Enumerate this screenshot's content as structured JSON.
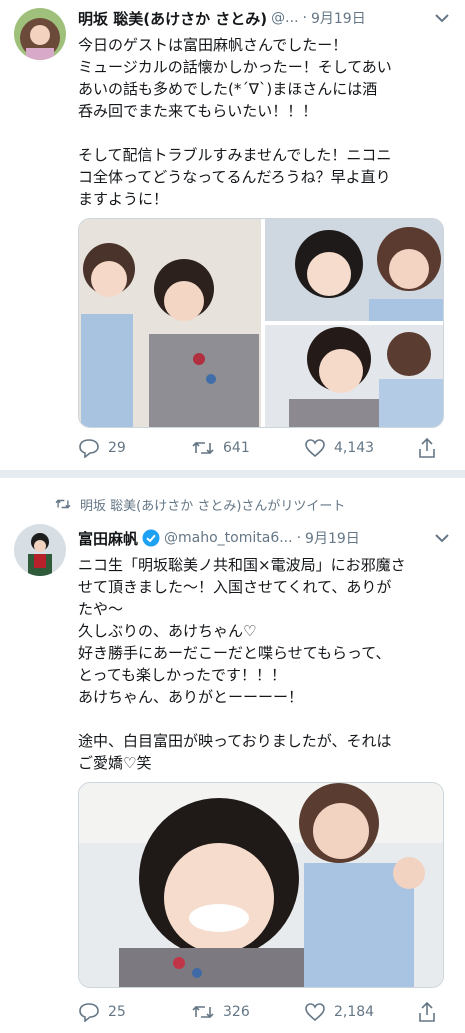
{
  "tweet1": {
    "author_name": "明坂 聡美(あけさか さとみ)",
    "author_handle": "@...",
    "dot": "·",
    "date": "9月19日",
    "lines": [
      "今日のゲストは富田麻帆さんでしたー！",
      "ミュージカルの話懐かしかったー！そしてあい",
      "あいの話も多めでした(*ˊ∇ˋ)まほさんには酒",
      "呑み回でまた来てもらいたい！！！",
      "",
      "そして配信トラブルすみませんでした！ニコニ",
      "コ全体ってどうなってるんだろうね？早よ直り",
      "ますように！"
    ],
    "replies": "29",
    "retweets": "641",
    "likes": "4,143"
  },
  "tweet2": {
    "retweet_note": "明坂 聡美(あけさか さとみ)さんがリツイート",
    "author_name": "富田麻帆",
    "author_handle": "@maho_tomita6...",
    "dot": "·",
    "date": "9月19日",
    "lines": [
      "ニコ生「明坂聡美ノ共和国×電波局」にお邪魔さ",
      "せて頂きました〜！入国させてくれて、ありが",
      "たや〜",
      "久しぶりの、あけちゃん♡",
      "好き勝手にあーだこーだと喋らせてもらって、",
      "とっても楽しかったです！！！",
      "あけちゃん、ありがとーーーー！",
      "",
      "途中、白目富田が映っておりましたが、それは",
      "ご愛嬌♡笑"
    ],
    "replies": "25",
    "retweets": "326",
    "likes": "2,184"
  },
  "colors": {
    "text": "#14171a",
    "muted": "#657786",
    "verified": "#1da1f2",
    "separator": "#e6ecf0"
  },
  "icons": [
    "reply-icon",
    "retweet-icon",
    "like-icon",
    "share-icon",
    "chevron-down-icon",
    "verified-badge-icon"
  ]
}
